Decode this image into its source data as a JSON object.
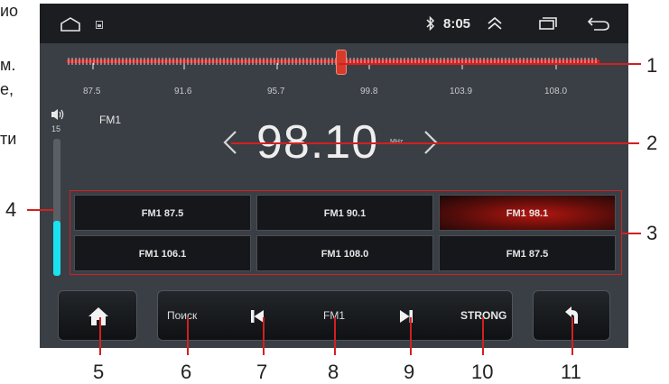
{
  "left_text_fragments": [
    "ио",
    "м.",
    "е,",
    "ти"
  ],
  "status_bar": {
    "time": "8:05",
    "icons": [
      "home-outline-icon",
      "sim-icon",
      "bluetooth-icon",
      "double-chevron-up-icon",
      "recent-apps-icon",
      "back-arrow-icon"
    ]
  },
  "tuner": {
    "scale_labels": [
      "87.5",
      "91.6",
      "95.7",
      "99.8",
      "103.9",
      "108.0"
    ],
    "band": "FM1",
    "frequency": "98.10",
    "unit": "MHz",
    "volume_level": "15",
    "volume_fraction": 0.4
  },
  "presets": [
    {
      "label": "FM1 87.5",
      "active": false
    },
    {
      "label": "FM1 90.1",
      "active": false
    },
    {
      "label": "FM1 98.1",
      "active": true
    },
    {
      "label": "FM1 106.1",
      "active": false
    },
    {
      "label": "FM1 108.0",
      "active": false
    },
    {
      "label": "FM1 87.5",
      "active": false
    }
  ],
  "bottom_bar": {
    "search_label": "Поиск",
    "band_label": "FM1",
    "signal_label": "STRONG"
  },
  "callouts": [
    "1",
    "2",
    "3",
    "4",
    "5",
    "6",
    "7",
    "8",
    "9",
    "10",
    "11"
  ],
  "colors": {
    "accent_red": "#d32020",
    "volume_cyan": "#19e3f0",
    "screen_bg": "#3a3f45"
  }
}
